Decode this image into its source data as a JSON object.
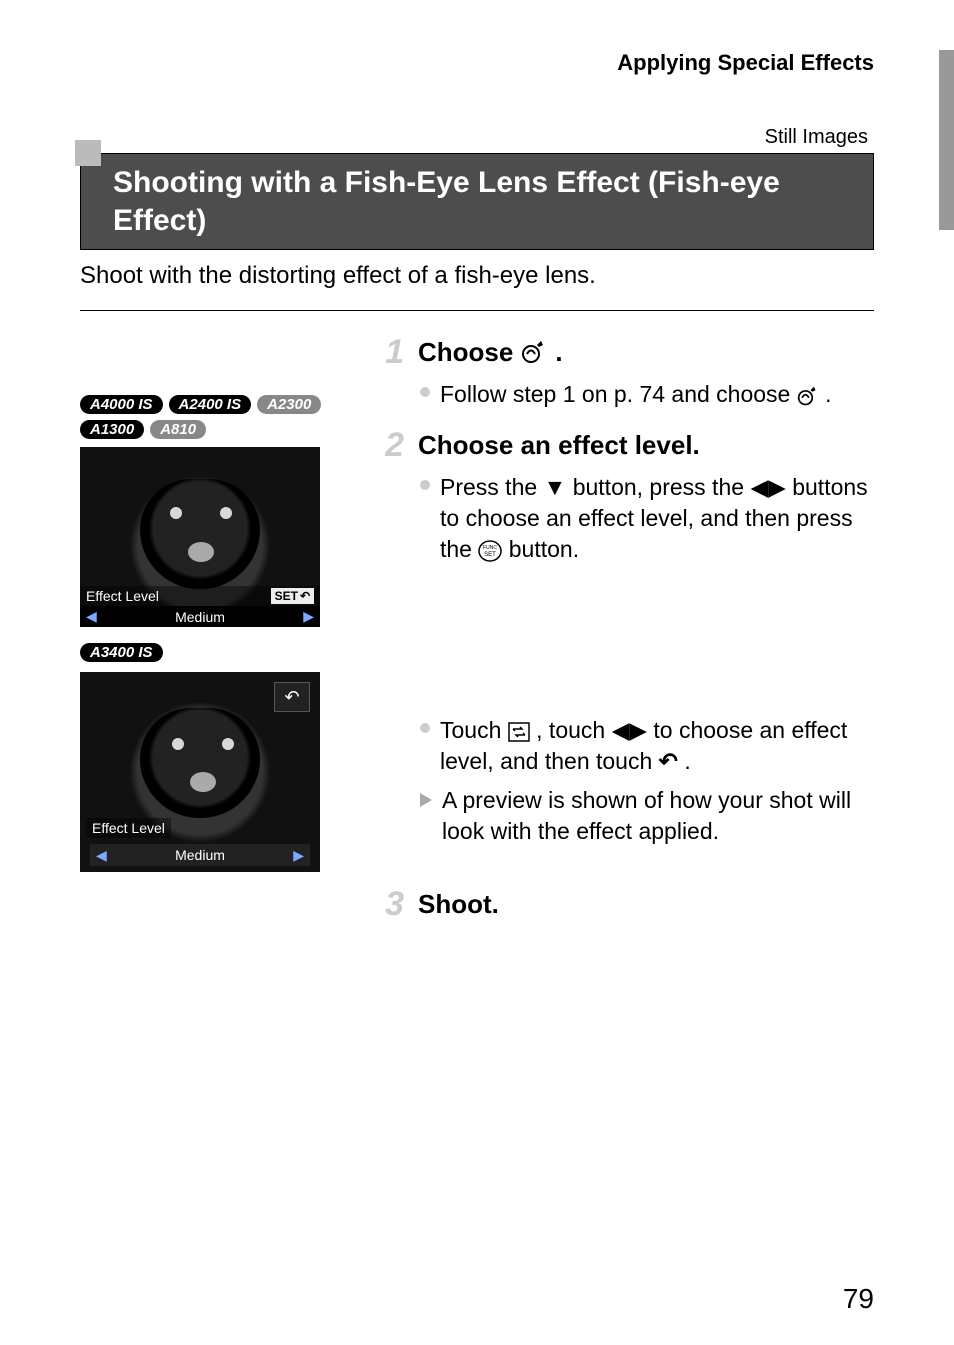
{
  "header": {
    "section": "Applying Special Effects"
  },
  "mode_label": "Still Images",
  "title": "Shooting with a Fish-Eye Lens Effect (Fish-eye Effect)",
  "intro": "Shoot with the distorting effect of a fish-eye lens.",
  "steps": {
    "s1": {
      "num": "1",
      "title_prefix": "Choose ",
      "title_suffix": "."
    },
    "s2": {
      "num": "2",
      "title": "Choose an effect level."
    },
    "s3": {
      "num": "3",
      "title": "Shoot."
    }
  },
  "bullets": {
    "b1a": "Follow step 1 on p. 74 and choose ",
    "b1b": ".",
    "b2a": "Press the ",
    "b2b": " button, press the ",
    "b2c": " buttons to choose an effect level, and then press the ",
    "b2d": " button.",
    "b3a": "Touch ",
    "b3b": ", touch ",
    "b3c": " to choose an effect level, and then touch ",
    "b3d": ".",
    "b4": "A preview is shown of how your shot will look with the effect applied."
  },
  "tags": {
    "group1": [
      "A4000 IS",
      "A2400 IS",
      "A2300",
      "A1300",
      "A810"
    ],
    "group2": [
      "A3400 IS"
    ]
  },
  "lcd1": {
    "effect_label": "Effect Level",
    "set_label": "SET",
    "value": "Medium"
  },
  "lcd2": {
    "effect_label": "Effect Level",
    "value": "Medium"
  },
  "icons": {
    "fisheye": "fisheye-mode-icon",
    "down": "▼",
    "leftright": "◀▶",
    "func_set": "FUNC SET",
    "menu_swap": "menu-swap-icon",
    "back": "↶"
  },
  "page_number": "79"
}
